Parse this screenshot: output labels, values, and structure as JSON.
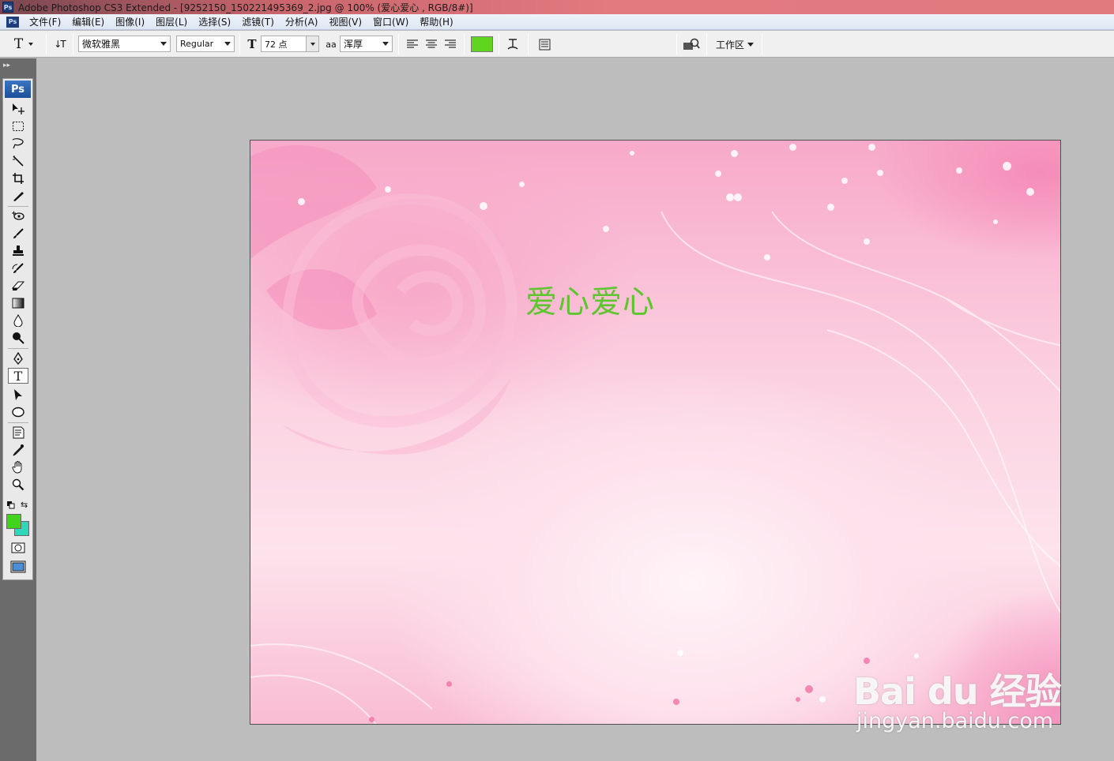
{
  "window": {
    "app_icon": "Ps",
    "title": "Adobe Photoshop CS3 Extended - [9252150_150221495369_2.jpg @ 100% (爱心爱心 , RGB/8#)]"
  },
  "menu": {
    "app_icon": "Ps",
    "items": [
      "文件(F)",
      "编辑(E)",
      "图像(I)",
      "图层(L)",
      "选择(S)",
      "滤镜(T)",
      "分析(A)",
      "视图(V)",
      "窗口(W)",
      "帮助(H)"
    ]
  },
  "options": {
    "tool_glyph": "T",
    "orient_glyph": "↓T",
    "font_family": "微软雅黑",
    "font_style": "Regular",
    "size_glyph": "T",
    "font_size": "72 点",
    "aa_glyph": "aa",
    "antialias": "浑厚",
    "text_color": "#5fd51f",
    "workspace_label": "工作区"
  },
  "toolbox": {
    "logo": "Ps",
    "fg_color": "#43d21e",
    "bg_color": "#2fd6b7"
  },
  "canvas": {
    "text": "爱心爱心",
    "text_color": "#5fc52e"
  },
  "watermark": {
    "logo_text": "Bai du 经验",
    "url": "jingyan.baidu.com"
  }
}
